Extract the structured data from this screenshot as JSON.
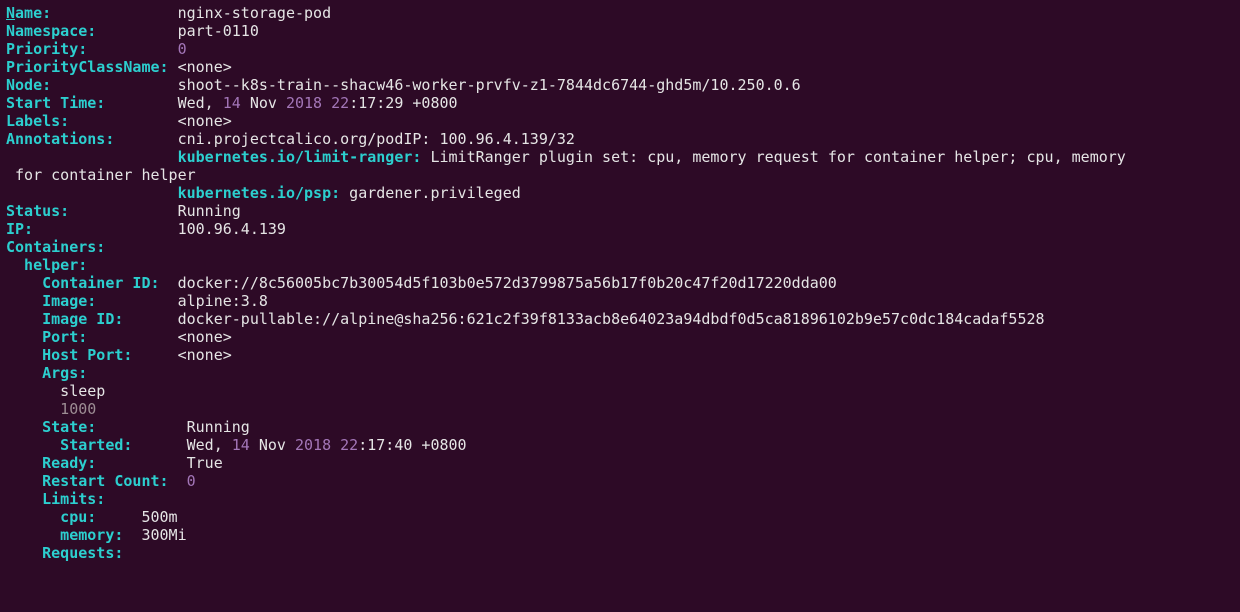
{
  "lines": [
    {
      "segs": [
        {
          "c": "cyan",
          "u": true,
          "t": "N"
        },
        {
          "c": "cyan",
          "t": "ame:              "
        },
        {
          "c": "white",
          "t": "nginx-storage-pod"
        }
      ]
    },
    {
      "segs": [
        {
          "c": "cyan",
          "t": "Namespace:         "
        },
        {
          "c": "white",
          "t": "part-0110"
        }
      ]
    },
    {
      "segs": [
        {
          "c": "cyan",
          "t": "Priority:          "
        },
        {
          "c": "num",
          "t": "0"
        }
      ]
    },
    {
      "segs": [
        {
          "c": "cyan",
          "t": "PriorityClassName: "
        },
        {
          "c": "white",
          "t": "<none>"
        }
      ]
    },
    {
      "segs": [
        {
          "c": "cyan",
          "t": "Node:              "
        },
        {
          "c": "white",
          "t": "shoot--k8s-train--shacw46-worker-prvfv-z1-7844dc6744-ghd5m/10.250.0.6"
        }
      ]
    },
    {
      "segs": [
        {
          "c": "cyan",
          "t": "Start Time:        "
        },
        {
          "c": "white",
          "t": "Wed, "
        },
        {
          "c": "num",
          "t": "14"
        },
        {
          "c": "white",
          "t": " Nov "
        },
        {
          "c": "num",
          "t": "2018"
        },
        {
          "c": "white",
          "t": " "
        },
        {
          "c": "num",
          "t": "22"
        },
        {
          "c": "white",
          "t": ":17:29 +0800"
        }
      ]
    },
    {
      "segs": [
        {
          "c": "cyan",
          "t": "Labels:            "
        },
        {
          "c": "white",
          "t": "<none>"
        }
      ]
    },
    {
      "segs": [
        {
          "c": "cyan",
          "t": "Annotations:       "
        },
        {
          "c": "white",
          "t": "cni.projectcalico.org/podIP: 100.96.4.139/32"
        }
      ]
    },
    {
      "segs": [
        {
          "c": "white",
          "t": "                   "
        },
        {
          "c": "cyan",
          "t": "kubernetes.io/limit-ranger:"
        },
        {
          "c": "white",
          "t": " LimitRanger plugin set: cpu, memory request for container helper; cpu, memory"
        }
      ]
    },
    {
      "segs": [
        {
          "c": "white",
          "t": " for container helper"
        }
      ]
    },
    {
      "segs": [
        {
          "c": "white",
          "t": "                   "
        },
        {
          "c": "cyan",
          "t": "kubernetes.io/psp:"
        },
        {
          "c": "white",
          "t": " gardener.privileged"
        }
      ]
    },
    {
      "segs": [
        {
          "c": "cyan",
          "t": "Status:            "
        },
        {
          "c": "white",
          "t": "Running"
        }
      ]
    },
    {
      "segs": [
        {
          "c": "cyan",
          "t": "IP:                "
        },
        {
          "c": "white",
          "t": "100.96.4.139"
        }
      ]
    },
    {
      "segs": [
        {
          "c": "cyan",
          "t": "Containers:"
        }
      ]
    },
    {
      "segs": [
        {
          "c": "cyan",
          "t": "  helper:"
        }
      ]
    },
    {
      "segs": [
        {
          "c": "cyan",
          "t": "    Container ID:  "
        },
        {
          "c": "white",
          "t": "docker://8c56005bc7b30054d5f103b0e572d3799875a56b17f0b20c47f20d17220dda00"
        }
      ]
    },
    {
      "segs": [
        {
          "c": "cyan",
          "t": "    Image:         "
        },
        {
          "c": "white",
          "t": "alpine:3.8"
        }
      ]
    },
    {
      "segs": [
        {
          "c": "cyan",
          "t": "    Image ID:      "
        },
        {
          "c": "white",
          "t": "docker-pullable://alpine@sha256:621c2f39f8133acb8e64023a94dbdf0d5ca81896102b9e57c0dc184cadaf5528"
        }
      ]
    },
    {
      "segs": [
        {
          "c": "cyan",
          "t": "    Port:          "
        },
        {
          "c": "white",
          "t": "<none>"
        }
      ]
    },
    {
      "segs": [
        {
          "c": "cyan",
          "t": "    Host Port:     "
        },
        {
          "c": "white",
          "t": "<none>"
        }
      ]
    },
    {
      "segs": [
        {
          "c": "cyan",
          "t": "    Args:"
        }
      ]
    },
    {
      "segs": [
        {
          "c": "white",
          "t": "      sleep"
        }
      ]
    },
    {
      "segs": [
        {
          "c": "gray",
          "t": "      1000"
        }
      ]
    },
    {
      "segs": [
        {
          "c": "cyan",
          "t": "    State:          "
        },
        {
          "c": "white",
          "t": "Running"
        }
      ]
    },
    {
      "segs": [
        {
          "c": "cyan",
          "t": "      Started:      "
        },
        {
          "c": "white",
          "t": "Wed, "
        },
        {
          "c": "num",
          "t": "14"
        },
        {
          "c": "white",
          "t": " Nov "
        },
        {
          "c": "num",
          "t": "2018"
        },
        {
          "c": "white",
          "t": " "
        },
        {
          "c": "num",
          "t": "22"
        },
        {
          "c": "white",
          "t": ":17:40 +0800"
        }
      ]
    },
    {
      "segs": [
        {
          "c": "cyan",
          "t": "    Ready:          "
        },
        {
          "c": "white",
          "t": "True"
        }
      ]
    },
    {
      "segs": [
        {
          "c": "cyan",
          "t": "    Restart Count:  "
        },
        {
          "c": "num",
          "t": "0"
        }
      ]
    },
    {
      "segs": [
        {
          "c": "cyan",
          "t": "    Limits:"
        }
      ]
    },
    {
      "segs": [
        {
          "c": "cyan",
          "t": "      cpu:     "
        },
        {
          "c": "white",
          "t": "500m"
        }
      ]
    },
    {
      "segs": [
        {
          "c": "cyan",
          "t": "      memory:  "
        },
        {
          "c": "white",
          "t": "300Mi"
        }
      ]
    },
    {
      "segs": [
        {
          "c": "cyan",
          "t": "    Requests:"
        }
      ]
    }
  ]
}
